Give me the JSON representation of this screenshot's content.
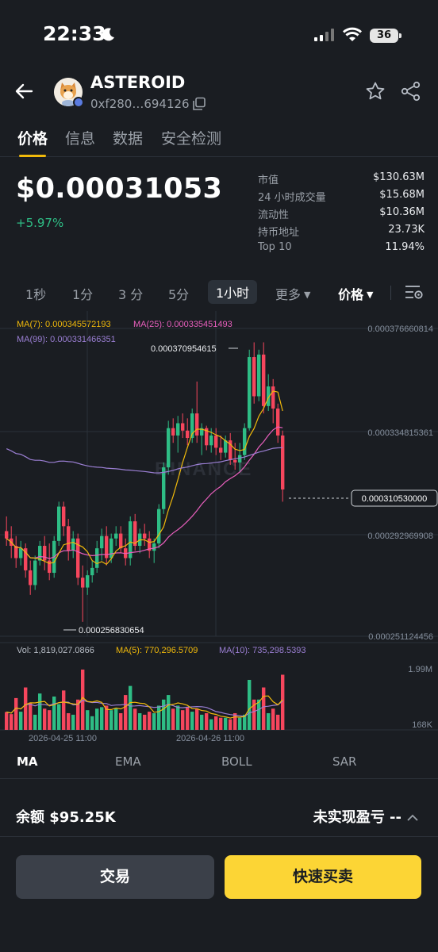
{
  "status_bar": {
    "time": "22:33",
    "battery": "36"
  },
  "header": {
    "token_name": "ASTEROID",
    "address": "0xf280…694126"
  },
  "tabs": [
    {
      "label": "价格",
      "active": true
    },
    {
      "label": "信息",
      "active": false
    },
    {
      "label": "数据",
      "active": false
    },
    {
      "label": "安全检测",
      "active": false
    }
  ],
  "price": {
    "value": "$0.00031053",
    "change": "+5.97%"
  },
  "stats": [
    {
      "label": "市值",
      "value": "$130.63M"
    },
    {
      "label": "24 小时成交量",
      "value": "$15.68M"
    },
    {
      "label": "流动性",
      "value": "$10.36M"
    },
    {
      "label": "持币地址",
      "value": "23.73K"
    },
    {
      "label": "Top 10",
      "value": "11.94%"
    }
  ],
  "intervals": [
    {
      "label": "1秒",
      "active": false
    },
    {
      "label": "1分",
      "active": false
    },
    {
      "label": "3 分",
      "active": false
    },
    {
      "label": "5分",
      "active": false
    },
    {
      "label": "1小时",
      "active": true
    }
  ],
  "more_label": "更多",
  "price_type_label": "价格",
  "chart_data": {
    "type": "candlestick",
    "watermark": "BINANCE",
    "ma_legend": {
      "ma7": "MA(7): 0.000345572193",
      "ma25": "MA(25): 0.000335451493",
      "ma99": "MA(99): 0.000331466351"
    },
    "y_axis_labels": [
      "0.000376660814",
      "0.000334815361",
      "0.000292969908",
      "0.000251124456"
    ],
    "ylim": [
      0.000251124456,
      0.000376660814
    ],
    "current_price_label": "0.000310530000",
    "current_price": 0.00031053,
    "high_annotation": "0.000370954615",
    "low_annotation": "0.000256830654",
    "x_labels": [
      "2026-04-25 11:00",
      "2026-04-26 11:00"
    ],
    "volume_legend": {
      "vol": "Vol: 1,819,027.0866",
      "ma5": "MA(5): 770,296.5709",
      "ma10": "MA(10): 735,298.5393"
    },
    "volume_axis_labels": [
      "1.99M",
      "168K"
    ],
    "volume_ylim": [
      168000,
      1990000
    ],
    "candles": [
      {
        "o": 0.000294,
        "h": 0.0003,
        "l": 0.000288,
        "c": 0.000291,
        "v": 590000
      },
      {
        "o": 0.000291,
        "h": 0.000296,
        "l": 0.000283,
        "c": 0.000288,
        "v": 520000
      },
      {
        "o": 0.000288,
        "h": 0.000292,
        "l": 0.000279,
        "c": 0.000283,
        "v": 1050000
      },
      {
        "o": 0.000283,
        "h": 0.00029,
        "l": 0.00028,
        "c": 0.000287,
        "v": 600000
      },
      {
        "o": 0.000287,
        "h": 0.000289,
        "l": 0.000275,
        "c": 0.000278,
        "v": 1400000
      },
      {
        "o": 0.000278,
        "h": 0.000282,
        "l": 0.000268,
        "c": 0.000272,
        "v": 900000
      },
      {
        "o": 0.000272,
        "h": 0.000284,
        "l": 0.00027,
        "c": 0.000282,
        "v": 500000
      },
      {
        "o": 0.000282,
        "h": 0.00029,
        "l": 0.00028,
        "c": 0.000288,
        "v": 1200000
      },
      {
        "o": 0.000288,
        "h": 0.000292,
        "l": 0.000278,
        "c": 0.000282,
        "v": 700000
      },
      {
        "o": 0.000282,
        "h": 0.000289,
        "l": 0.000274,
        "c": 0.000277,
        "v": 650000
      },
      {
        "o": 0.000277,
        "h": 0.000292,
        "l": 0.000275,
        "c": 0.00029,
        "v": 1100000
      },
      {
        "o": 0.00029,
        "h": 0.000306,
        "l": 0.000288,
        "c": 0.000304,
        "v": 850000
      },
      {
        "o": 0.000304,
        "h": 0.000306,
        "l": 0.000292,
        "c": 0.000296,
        "v": 1300000
      },
      {
        "o": 0.000296,
        "h": 0.000299,
        "l": 0.000282,
        "c": 0.000286,
        "v": 550000
      },
      {
        "o": 0.000286,
        "h": 0.000294,
        "l": 0.000283,
        "c": 0.000291,
        "v": 500000
      },
      {
        "o": 0.000291,
        "h": 0.000293,
        "l": 0.000272,
        "c": 0.000275,
        "v": 1000000
      },
      {
        "o": 0.000275,
        "h": 0.00028,
        "l": 0.000257,
        "c": 0.000271,
        "v": 1990000
      },
      {
        "o": 0.000271,
        "h": 0.000278,
        "l": 0.000268,
        "c": 0.000276,
        "v": 650000
      },
      {
        "o": 0.000276,
        "h": 0.000282,
        "l": 0.000273,
        "c": 0.000279,
        "v": 450000
      },
      {
        "o": 0.000279,
        "h": 0.00029,
        "l": 0.000277,
        "c": 0.000287,
        "v": 700000
      },
      {
        "o": 0.000287,
        "h": 0.000295,
        "l": 0.000282,
        "c": 0.000292,
        "v": 750000
      },
      {
        "o": 0.000292,
        "h": 0.000296,
        "l": 0.00028,
        "c": 0.000283,
        "v": 800000
      },
      {
        "o": 0.000283,
        "h": 0.000293,
        "l": 0.000281,
        "c": 0.000291,
        "v": 650000
      },
      {
        "o": 0.000291,
        "h": 0.000296,
        "l": 0.000288,
        "c": 0.000293,
        "v": 700000
      },
      {
        "o": 0.000293,
        "h": 0.000296,
        "l": 0.000285,
        "c": 0.000287,
        "v": 550000
      },
      {
        "o": 0.000287,
        "h": 0.000291,
        "l": 0.00028,
        "c": 0.000283,
        "v": 1150000
      },
      {
        "o": 0.000283,
        "h": 0.0003,
        "l": 0.00028,
        "c": 0.000298,
        "v": 1450000
      },
      {
        "o": 0.000298,
        "h": 0.000301,
        "l": 0.000286,
        "c": 0.000288,
        "v": 700000
      },
      {
        "o": 0.000288,
        "h": 0.000295,
        "l": 0.000285,
        "c": 0.000293,
        "v": 550000
      },
      {
        "o": 0.000293,
        "h": 0.000297,
        "l": 0.000288,
        "c": 0.000291,
        "v": 500000
      },
      {
        "o": 0.000291,
        "h": 0.000294,
        "l": 0.000283,
        "c": 0.000286,
        "v": 600000
      },
      {
        "o": 0.000286,
        "h": 0.000291,
        "l": 0.000281,
        "c": 0.000289,
        "v": 550000
      },
      {
        "o": 0.000289,
        "h": 0.000305,
        "l": 0.000287,
        "c": 0.000303,
        "v": 800000
      },
      {
        "o": 0.000303,
        "h": 0.000322,
        "l": 0.000301,
        "c": 0.00032,
        "v": 1000000
      },
      {
        "o": 0.00032,
        "h": 0.000339,
        "l": 0.000317,
        "c": 0.000336,
        "v": 1150000
      },
      {
        "o": 0.000336,
        "h": 0.00034,
        "l": 0.00033,
        "c": 0.000333,
        "v": 700000
      },
      {
        "o": 0.000333,
        "h": 0.000341,
        "l": 0.000326,
        "c": 0.000338,
        "v": 800000
      },
      {
        "o": 0.000338,
        "h": 0.000342,
        "l": 0.000332,
        "c": 0.000335,
        "v": 650000
      },
      {
        "o": 0.000335,
        "h": 0.00034,
        "l": 0.000329,
        "c": 0.000332,
        "v": 750000
      },
      {
        "o": 0.000332,
        "h": 0.000344,
        "l": 0.00033,
        "c": 0.000342,
        "v": 600000
      },
      {
        "o": 0.000342,
        "h": 0.000355,
        "l": 0.00033,
        "c": 0.000333,
        "v": 700000
      },
      {
        "o": 0.000333,
        "h": 0.000338,
        "l": 0.000325,
        "c": 0.000336,
        "v": 500000
      },
      {
        "o": 0.000336,
        "h": 0.000337,
        "l": 0.000327,
        "c": 0.000329,
        "v": 550000
      },
      {
        "o": 0.000329,
        "h": 0.000336,
        "l": 0.000326,
        "c": 0.000333,
        "v": 350000
      },
      {
        "o": 0.000333,
        "h": 0.000336,
        "l": 0.000325,
        "c": 0.000328,
        "v": 450000
      },
      {
        "o": 0.000328,
        "h": 0.000333,
        "l": 0.000323,
        "c": 0.000326,
        "v": 400000
      },
      {
        "o": 0.000326,
        "h": 0.000333,
        "l": 0.000324,
        "c": 0.000331,
        "v": 400000
      },
      {
        "o": 0.000331,
        "h": 0.000334,
        "l": 0.000321,
        "c": 0.000323,
        "v": 350000
      },
      {
        "o": 0.000323,
        "h": 0.00033,
        "l": 0.000319,
        "c": 0.000322,
        "v": 550000
      },
      {
        "o": 0.000322,
        "h": 0.00033,
        "l": 0.000318,
        "c": 0.000325,
        "v": 400000
      },
      {
        "o": 0.000325,
        "h": 0.000338,
        "l": 0.000323,
        "c": 0.000336,
        "v": 500000
      },
      {
        "o": 0.000336,
        "h": 0.000368,
        "l": 0.000335,
        "c": 0.000365,
        "v": 1650000
      },
      {
        "o": 0.000365,
        "h": 0.000371,
        "l": 0.000346,
        "c": 0.000349,
        "v": 1000000
      },
      {
        "o": 0.000349,
        "h": 0.000368,
        "l": 0.000347,
        "c": 0.000366,
        "v": 1000000
      },
      {
        "o": 0.000366,
        "h": 0.000371,
        "l": 0.000342,
        "c": 0.000345,
        "v": 1400000
      },
      {
        "o": 0.000345,
        "h": 0.000358,
        "l": 0.000343,
        "c": 0.000353,
        "v": 550000
      },
      {
        "o": 0.000353,
        "h": 0.000356,
        "l": 0.000338,
        "c": 0.000344,
        "v": 700000
      },
      {
        "o": 0.000344,
        "h": 0.000346,
        "l": 0.00033,
        "c": 0.000333,
        "v": 500000
      },
      {
        "o": 0.000333,
        "h": 0.000335,
        "l": 0.000306,
        "c": 0.000311,
        "v": 1820000
      }
    ]
  },
  "indicators": [
    {
      "label": "MA",
      "active": true
    },
    {
      "label": "EMA",
      "active": false
    },
    {
      "label": "BOLL",
      "active": false
    },
    {
      "label": "SAR",
      "active": false
    }
  ],
  "balance": "余额 $95.25K",
  "pnl": "未实现盈亏 --",
  "buttons": {
    "trade": "交易",
    "quick_trade": "快速买卖"
  },
  "colors": {
    "up": "#2ebd85",
    "down": "#f6465d",
    "ma7": "#f0b90b",
    "ma25": "#e85fbd",
    "ma99": "#9b7fd4",
    "accent": "#fcd535"
  }
}
